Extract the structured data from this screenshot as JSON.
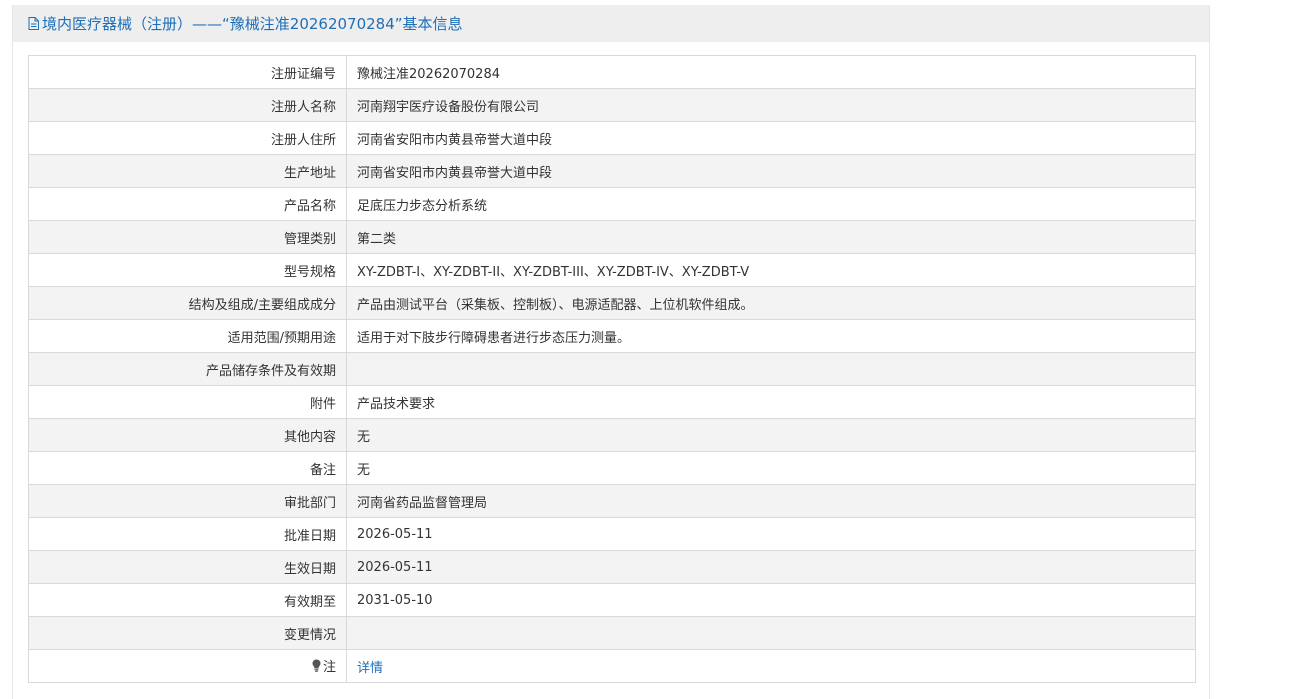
{
  "header": {
    "title": "境内医疗器械（注册）——“豫械注准20262070284”基本信息",
    "icon": "document-icon"
  },
  "rows": [
    {
      "label": "注册证编号",
      "value": "豫械注准20262070284"
    },
    {
      "label": "注册人名称",
      "value": "河南翔宇医疗设备股份有限公司"
    },
    {
      "label": "注册人住所",
      "value": "河南省安阳市内黄县帝誉大道中段"
    },
    {
      "label": "生产地址",
      "value": "河南省安阳市内黄县帝誉大道中段"
    },
    {
      "label": "产品名称",
      "value": "足底压力步态分析系统"
    },
    {
      "label": "管理类别",
      "value": "第二类"
    },
    {
      "label": "型号规格",
      "value": "XY-ZDBT-I、XY-ZDBT-II、XY-ZDBT-III、XY-ZDBT-IV、XY-ZDBT-V"
    },
    {
      "label": "结构及组成/主要组成成分",
      "value": "产品由测试平台（采集板、控制板）、电源适配器、上位机软件组成。"
    },
    {
      "label": "适用范围/预期用途",
      "value": "适用于对下肢步行障碍患者进行步态压力测量。"
    },
    {
      "label": "产品储存条件及有效期",
      "value": ""
    },
    {
      "label": "附件",
      "value": "产品技术要求"
    },
    {
      "label": "其他内容",
      "value": "无"
    },
    {
      "label": "备注",
      "value": "无"
    },
    {
      "label": "审批部门",
      "value": "河南省药品监督管理局"
    },
    {
      "label": "批准日期",
      "value": "2026-05-11"
    },
    {
      "label": "生效日期",
      "value": "2026-05-11"
    },
    {
      "label": "有效期至",
      "value": "2031-05-10"
    },
    {
      "label": "变更情况",
      "value": ""
    }
  ],
  "note_row": {
    "icon": "lightbulb-icon",
    "label": "注",
    "link_text": "详情"
  },
  "colors": {
    "accent": "#1e6fb8",
    "header_bg": "#eeeeee",
    "row_alt_bg": "#f3f3f3",
    "border": "#d9d9d9"
  }
}
